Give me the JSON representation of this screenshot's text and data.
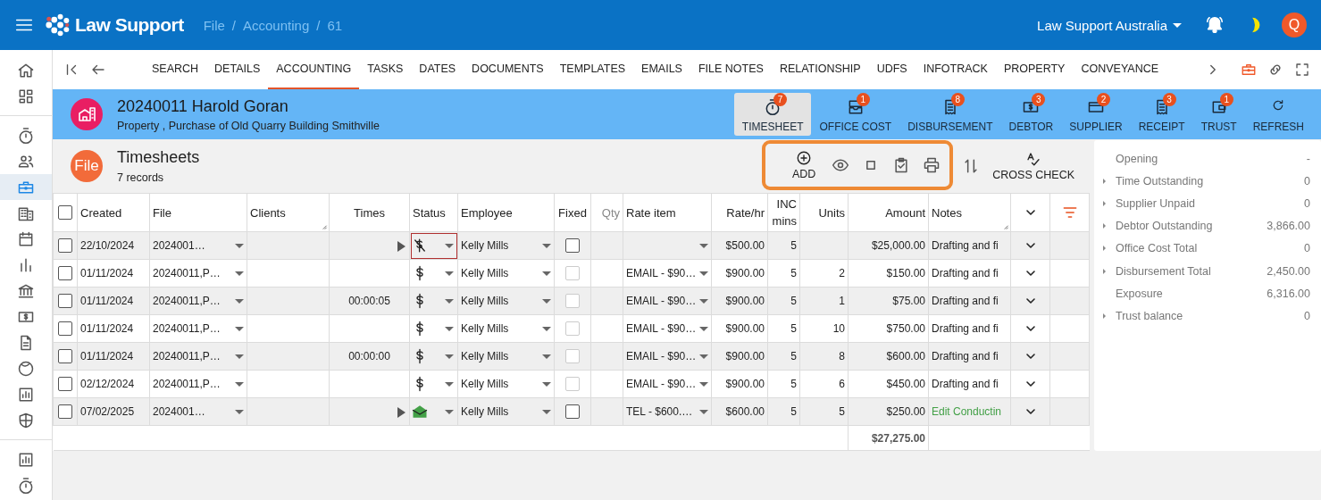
{
  "app": {
    "brand": "Law Support",
    "breadcrumbs": [
      {
        "label": "File"
      },
      {
        "separator": "/",
        "label": "Accounting"
      },
      {
        "separator": "/",
        "label": "61"
      }
    ],
    "organisation": "Law Support Australia",
    "avatar": "Q"
  },
  "sidebar": {
    "groups": [
      [
        {
          "kind": "home",
          "selected": false
        },
        {
          "kind": "dashboard",
          "selected": false
        }
      ],
      [
        {
          "kind": "stopwatch",
          "selected": false
        },
        {
          "kind": "people",
          "selected": false
        },
        {
          "kind": "briefcase",
          "selected": true
        },
        {
          "kind": "building",
          "selected": false
        },
        {
          "kind": "calendar",
          "selected": false
        },
        {
          "kind": "bar-chart",
          "selected": false
        },
        {
          "kind": "bank",
          "selected": false
        },
        {
          "kind": "dollar",
          "selected": false
        },
        {
          "kind": "document",
          "selected": false
        },
        {
          "kind": "face",
          "selected": false
        },
        {
          "kind": "report",
          "selected": false
        },
        {
          "kind": "shield",
          "selected": false
        }
      ],
      [
        {
          "kind": "report",
          "selected": false
        },
        {
          "kind": "stopwatch",
          "selected": false
        }
      ]
    ]
  },
  "tabs": [
    {
      "label": "SEARCH",
      "selected": false
    },
    {
      "label": "DETAILS",
      "selected": false
    },
    {
      "label": "ACCOUNTING",
      "selected": true
    },
    {
      "label": "TASKS",
      "selected": false
    },
    {
      "label": "DATES",
      "selected": false
    },
    {
      "label": "DOCUMENTS",
      "selected": false
    },
    {
      "label": "TEMPLATES",
      "selected": false
    },
    {
      "label": "EMAILS",
      "selected": false
    },
    {
      "label": "FILE NOTES",
      "selected": false
    },
    {
      "label": "RELATIONSHIP",
      "selected": false
    },
    {
      "label": "UDFS",
      "selected": false
    },
    {
      "label": "INFOTRACK",
      "selected": false
    },
    {
      "label": "PROPERTY",
      "selected": false
    },
    {
      "label": "CONVEYANCE",
      "selected": false
    }
  ],
  "file": {
    "title": "20240011 Harold Goran",
    "subtitle": "Property , Purchase of Old Quarry Building Smithville"
  },
  "toolbar": [
    {
      "kind": "stopwatch",
      "label": "TIMESHEET",
      "badge": "7",
      "selected": true
    },
    {
      "kind": "tray",
      "label": "OFFICE COST",
      "badge": "1",
      "selected": false
    },
    {
      "kind": "receipt",
      "label": "DISBURSEMENT",
      "badge": "8",
      "selected": false
    },
    {
      "kind": "dollar",
      "label": "DEBTOR",
      "badge": "3",
      "selected": false
    },
    {
      "kind": "card",
      "label": "SUPPLIER",
      "badge": "2",
      "selected": false
    },
    {
      "kind": "receipt",
      "label": "RECEIPT",
      "badge": "3",
      "selected": false
    },
    {
      "kind": "wallet",
      "label": "TRUST",
      "badge": "1",
      "selected": false
    },
    {
      "kind": "refresh",
      "label": "REFRESH",
      "selected": false
    }
  ],
  "section": {
    "badge": "File",
    "title": "Timesheets",
    "count": "7 records"
  },
  "actions": {
    "highlighted": true,
    "add_label": "ADD",
    "cross_check_label": "CROSS CHECK"
  },
  "table": {
    "all_selected": false,
    "columns": [
      "Created",
      "File",
      "Clients",
      "Times",
      "Status",
      "Employee",
      "Fixed",
      "Qty",
      "Rate item",
      "Rate/hr",
      "INC mins",
      "Units",
      "Amount",
      "Notes"
    ],
    "rows": [
      {
        "checked": false,
        "created": "22/10/2024",
        "file": "2024001…",
        "play": true,
        "status": {
          "kind": "pending"
        },
        "status_focused": true,
        "employee": "Kelly Mills",
        "fixed": false,
        "fixed_enabled": true,
        "rate": "$500.00",
        "inc": "5",
        "amount": "$25,000.00",
        "notes": "Drafting and fi",
        "notes_link": false
      },
      {
        "checked": false,
        "created": "01/11/2024",
        "file": "20240011,P…",
        "play": false,
        "status": {
          "kind": "paid"
        },
        "status_focused": false,
        "employee": "Kelly Mills",
        "fixed": false,
        "fixed_enabled": false,
        "rate_item": "EMAIL - $90…",
        "rate": "$900.00",
        "inc": "5",
        "units": "2",
        "amount": "$150.00",
        "notes": "Drafting and fi",
        "notes_link": false
      },
      {
        "checked": false,
        "created": "01/11/2024",
        "file": "20240011,P…",
        "times": "00:00:05",
        "play": false,
        "status": {
          "kind": "paid"
        },
        "status_focused": false,
        "employee": "Kelly Mills",
        "fixed": false,
        "fixed_enabled": false,
        "rate_item": "EMAIL - $90…",
        "rate": "$900.00",
        "inc": "5",
        "units": "1",
        "amount": "$75.00",
        "notes": "Drafting and fi",
        "notes_link": false
      },
      {
        "checked": false,
        "created": "01/11/2024",
        "file": "20240011,P…",
        "play": false,
        "status": {
          "kind": "paid"
        },
        "status_focused": false,
        "employee": "Kelly Mills",
        "fixed": false,
        "fixed_enabled": false,
        "rate_item": "EMAIL - $90…",
        "rate": "$900.00",
        "inc": "5",
        "units": "10",
        "amount": "$750.00",
        "notes": "Drafting and fi",
        "notes_link": false
      },
      {
        "checked": false,
        "created": "01/11/2024",
        "file": "20240011,P…",
        "times": "00:00:00",
        "play": false,
        "status": {
          "kind": "paid"
        },
        "status_focused": false,
        "employee": "Kelly Mills",
        "fixed": false,
        "fixed_enabled": false,
        "rate_item": "EMAIL - $90…",
        "rate": "$900.00",
        "inc": "5",
        "units": "8",
        "amount": "$600.00",
        "notes": "Drafting and fi",
        "notes_link": false
      },
      {
        "checked": false,
        "created": "02/12/2024",
        "file": "20240011,P…",
        "play": false,
        "status": {
          "kind": "paid"
        },
        "status_focused": false,
        "employee": "Kelly Mills",
        "fixed": false,
        "fixed_enabled": false,
        "rate_item": "EMAIL - $90…",
        "rate": "$900.00",
        "inc": "5",
        "units": "6",
        "amount": "$450.00",
        "notes": "Drafting and fi",
        "notes_link": false
      },
      {
        "checked": false,
        "created": "07/02/2025",
        "file": "2024001…",
        "play": true,
        "status": {
          "kind": "email"
        },
        "status_focused": false,
        "employee": "Kelly Mills",
        "fixed": false,
        "fixed_enabled": true,
        "rate_item": "TEL - $600.…",
        "rate": "$600.00",
        "inc": "5",
        "units": "5",
        "amount": "$250.00",
        "notes": "Edit Conductin",
        "notes_link": true
      }
    ],
    "total": "$27,275.00"
  },
  "summary": [
    {
      "label": "Opening",
      "value": "-",
      "expandable": false
    },
    {
      "label": "Time Outstanding",
      "value": "0",
      "expandable": true
    },
    {
      "label": "Supplier Unpaid",
      "value": "0",
      "expandable": true
    },
    {
      "label": "Debtor Outstanding",
      "value": "3,866.00",
      "expandable": true
    },
    {
      "label": "Office Cost Total",
      "value": "0",
      "expandable": true
    },
    {
      "label": "Disbursement Total",
      "value": "2,450.00",
      "expandable": true
    },
    {
      "label": "Exposure",
      "value": "6,316.00",
      "expandable": false
    },
    {
      "label": "Trust balance",
      "value": "0",
      "expandable": true
    }
  ]
}
